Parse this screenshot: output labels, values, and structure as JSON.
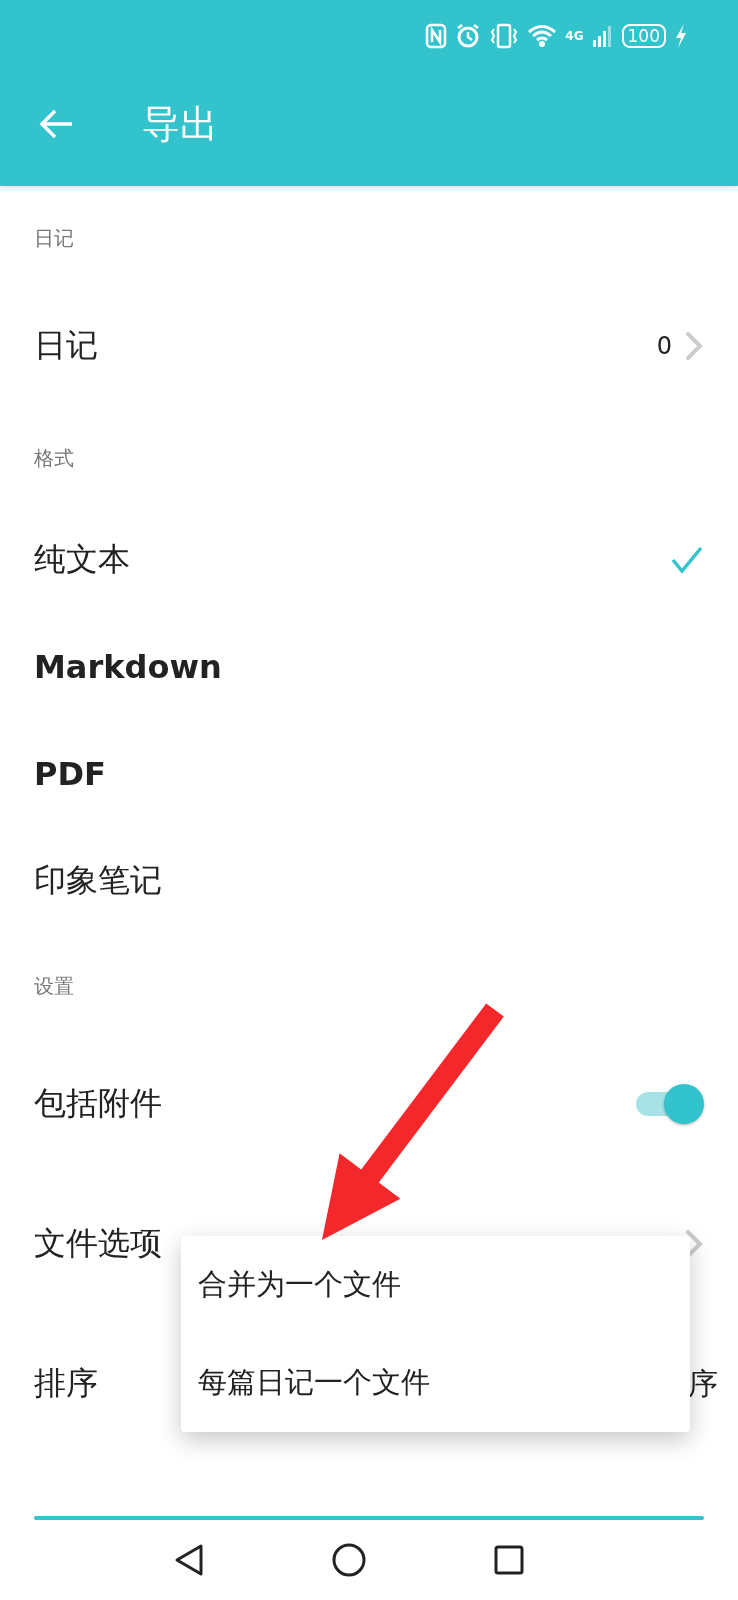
{
  "status_bar": {
    "network": "4G",
    "battery": "100"
  },
  "app_bar": {
    "title": "导出"
  },
  "sections": [
    {
      "header": "日记",
      "items": [
        {
          "kind": "link",
          "label": "日记",
          "value": "0"
        }
      ]
    },
    {
      "header": "格式",
      "items": [
        {
          "kind": "choice",
          "label": "纯文本",
          "selected": true
        },
        {
          "kind": "choice",
          "label": "Markdown",
          "selected": false
        },
        {
          "kind": "choice",
          "label": "PDF",
          "selected": false
        },
        {
          "kind": "choice",
          "label": "印象笔记",
          "selected": false
        }
      ]
    },
    {
      "header": "设置",
      "items": [
        {
          "kind": "switch",
          "label": "包括附件",
          "on": true
        },
        {
          "kind": "link",
          "label": "文件选项"
        },
        {
          "kind": "value",
          "label": "排序",
          "value": "序"
        }
      ]
    }
  ],
  "popup_menu": {
    "items": [
      "合并为一个文件",
      "每篇日记一个文件"
    ]
  }
}
